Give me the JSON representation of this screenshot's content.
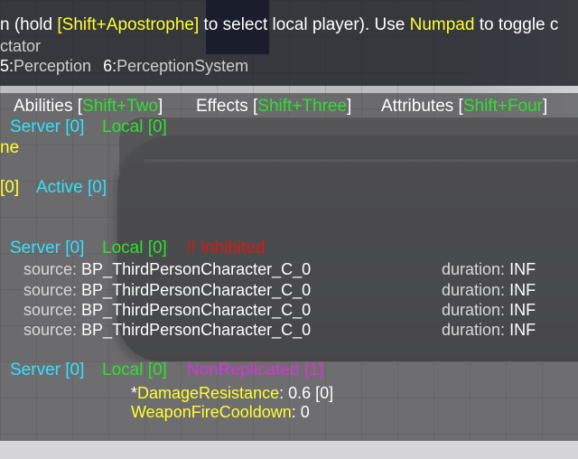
{
  "header": {
    "line1": {
      "prefix": "n (hold ",
      "key_select": "[Shift+Apostrophe]",
      "middle": " to select local player). Use ",
      "key_toggle": "Numpad",
      "suffix": " to toggle c"
    },
    "line2": "ctator",
    "line3": {
      "cat5_num": "5:",
      "cat5_name": "Perception",
      "cat6_num": "6:",
      "cat6_name": "PerceptionSystem"
    }
  },
  "tabs": [
    {
      "label": "Abilities",
      "open": " [",
      "key": "Shift+Two",
      "close": "]"
    },
    {
      "label": "Effects",
      "open": " [",
      "key": "Shift+Three",
      "close": "]"
    },
    {
      "label": "Attributes",
      "open": " [",
      "key": "Shift+Four",
      "close": "]"
    }
  ],
  "abilities_section": {
    "server": "Server [0]",
    "local": "Local [0]",
    "name_fragment": "ne",
    "count_fragment": "[0]",
    "active": "Active [0]"
  },
  "effects_section": {
    "server": "Server [0]",
    "local": "Local [0]",
    "inhibited": "!! Inhibited",
    "rows": [
      {
        "source_label": "source:",
        "source_value": "BP_ThirdPersonCharacter_C_0",
        "duration_label": "duration:",
        "duration_value": "INF"
      },
      {
        "source_label": "source:",
        "source_value": "BP_ThirdPersonCharacter_C_0",
        "duration_label": "duration:",
        "duration_value": "INF"
      },
      {
        "source_label": "source:",
        "source_value": "BP_ThirdPersonCharacter_C_0",
        "duration_label": "duration:",
        "duration_value": "INF"
      },
      {
        "source_label": "source:",
        "source_value": "BP_ThirdPersonCharacter_C_0",
        "duration_label": "duration:",
        "duration_value": "INF"
      }
    ]
  },
  "attributes_section": {
    "server": "Server [0]",
    "local": "Local [0]",
    "non_replicated": "NonReplicated [1]",
    "attrs": [
      {
        "marker": "*",
        "name": "DamageResistance",
        "sep": ": ",
        "value": "0.6 [0]"
      },
      {
        "marker": "",
        "name": "WeaponFireCooldown",
        "sep": ": ",
        "value": "0"
      }
    ]
  },
  "colors": {
    "key_hint": "#ffff30",
    "tab_key": "#2fe02f",
    "server": "#33e1ff",
    "local": "#2fe02f",
    "inhibited": "#e01515",
    "non_replicated": "#d236d2",
    "attribute_name": "#ffff30"
  }
}
